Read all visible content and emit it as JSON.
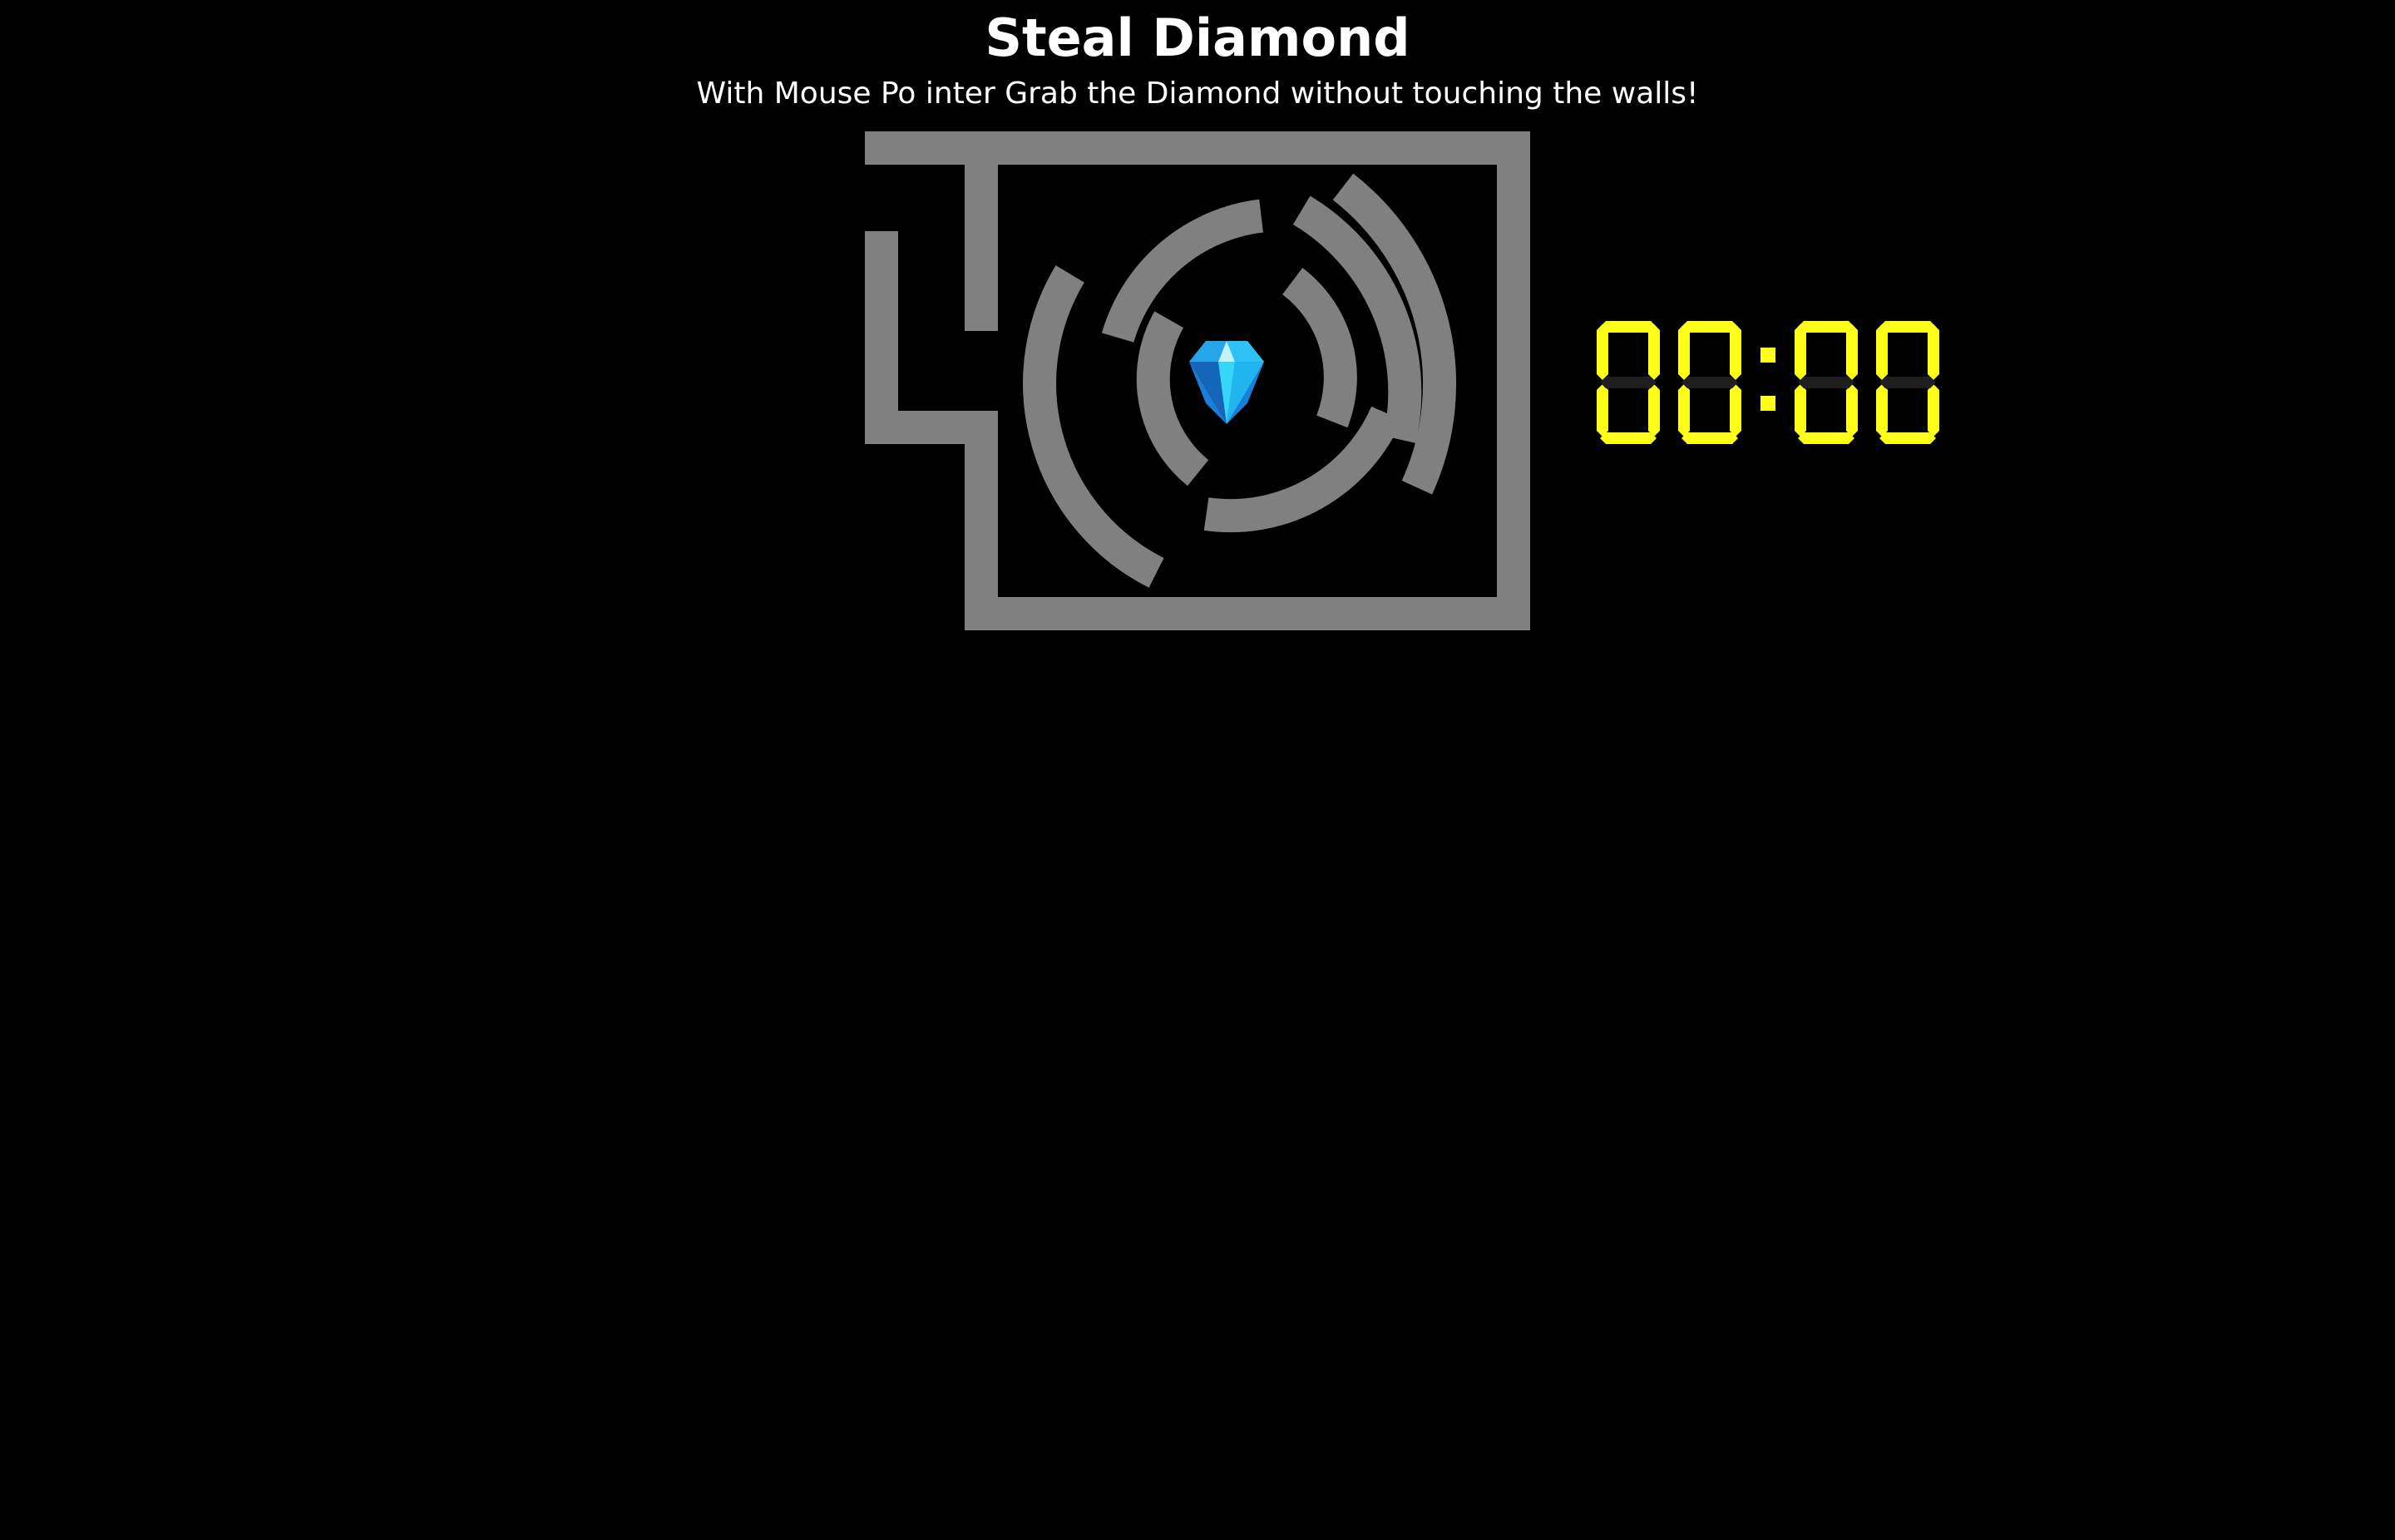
{
  "header": {
    "title": "Steal Diamond",
    "subtitle": "With Mouse Po inter Grab the Diamond without touching the walls!"
  },
  "game": {
    "goal_icon": "diamond-icon",
    "wall_color": "#808080",
    "background_color": "#000000"
  },
  "timer": {
    "minutes": "00",
    "seconds": "00",
    "separator": ":",
    "digit_color": "#ffff1a",
    "inactive_segment_color": "#1e1e1e"
  }
}
